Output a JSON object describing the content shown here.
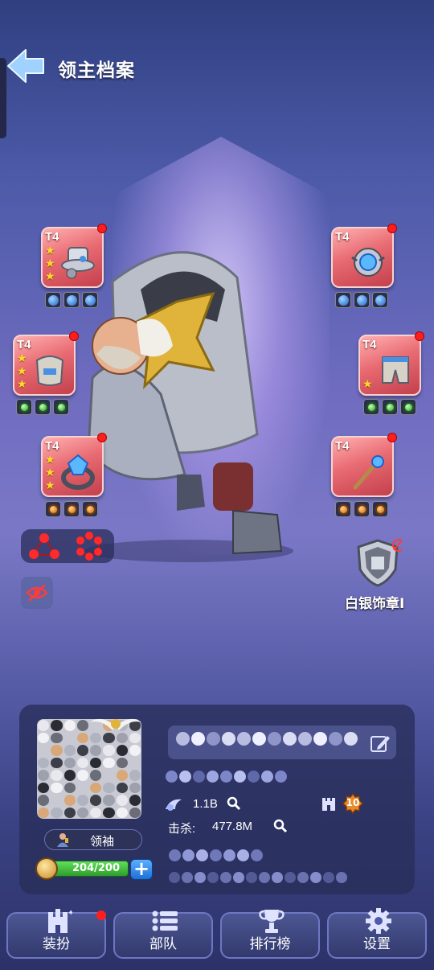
{
  "header": {
    "title": "领主档案"
  },
  "equipment": {
    "tier_label": "T4",
    "slots": [
      {
        "id": "helmet",
        "tier": "T4",
        "stars": 3,
        "gem_color": "blue"
      },
      {
        "id": "accessory-orb",
        "tier": "T4",
        "stars": 0,
        "gem_color": "blue"
      },
      {
        "id": "armor",
        "tier": "T4",
        "stars": 3,
        "gem_color": "green"
      },
      {
        "id": "legs",
        "tier": "T4",
        "stars": 1,
        "gem_color": "green"
      },
      {
        "id": "ring",
        "tier": "T4",
        "stars": 3,
        "gem_color": "orange"
      },
      {
        "id": "scepter",
        "tier": "T4",
        "stars": 0,
        "gem_color": "orange"
      }
    ]
  },
  "badge": {
    "label": "白银饰章I"
  },
  "profile": {
    "role_label": "领袖",
    "stamina": "204/200",
    "power": "1.1B",
    "kills_label": "击杀:",
    "kills_value": "477.8M",
    "level": "10"
  },
  "tabs": [
    {
      "label": "装扮",
      "icon": "castle-icon",
      "notify": true
    },
    {
      "label": "部队",
      "icon": "list-icon",
      "notify": false
    },
    {
      "label": "排行榜",
      "icon": "trophy-icon",
      "notify": false
    },
    {
      "label": "设置",
      "icon": "gear-icon",
      "notify": false
    }
  ],
  "colors": {
    "slot_red": "#e86a72",
    "notify_red": "#ff1e1e",
    "stamina_green": "#2f9d2c",
    "star_gold": "#ffd92b"
  }
}
